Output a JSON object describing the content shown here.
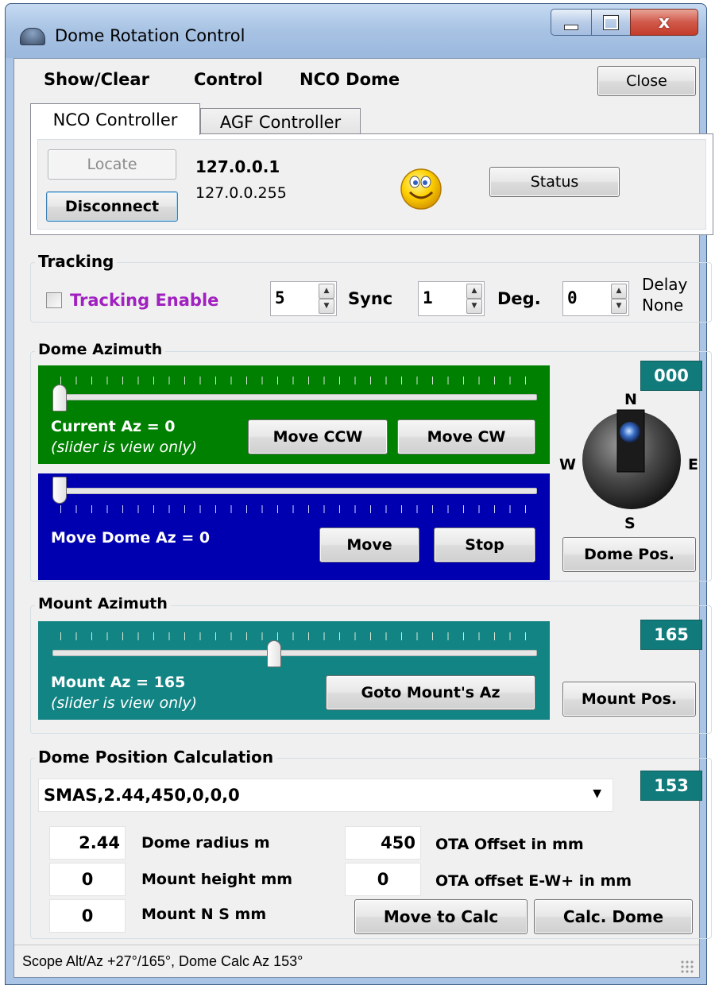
{
  "window": {
    "title": "Dome Rotation Control",
    "caption_buttons": {
      "minimize": "minimize",
      "maximize": "maximize",
      "close": "x"
    }
  },
  "menu": {
    "items": [
      "Show/Clear",
      "Control",
      "NCO Dome"
    ],
    "close_label": "Close"
  },
  "tabs": [
    {
      "label": "NCO Controller",
      "active": true
    },
    {
      "label": "AGF Controller",
      "active": false
    }
  ],
  "connection": {
    "locate_label": "Locate",
    "disconnect_label": "Disconnect",
    "ip_primary": "127.0.0.1",
    "ip_broadcast": "127.0.0.255",
    "status_icon": "smiley-icon",
    "status_label": "Status"
  },
  "tracking": {
    "title": "Tracking",
    "enable_label": "Tracking Enable",
    "enabled": false,
    "spin1_value": "5",
    "sync_label": "Sync",
    "spin2_value": "1",
    "deg_label": "Deg.",
    "spin3_value": "0",
    "delay_label": "Delay",
    "delay_value": "None"
  },
  "dome_azimuth": {
    "title": "Dome Azimuth",
    "readout": "000",
    "current_az_label": "Current Az = 0",
    "current_slider_value": 0,
    "view_only_note": "(slider is view only)",
    "move_ccw_label": "Move CCW",
    "move_cw_label": "Move CW",
    "move_dome_label": "Move Dome Az = 0",
    "move_slider_value": 0,
    "move_label": "Move",
    "stop_label": "Stop",
    "compass": {
      "n": "N",
      "s": "S",
      "e": "E",
      "w": "W"
    },
    "dome_pos_label": "Dome Pos."
  },
  "mount_azimuth": {
    "title": "Mount Azimuth",
    "readout": "165",
    "mount_az_label": "Mount Az = 165",
    "slider_value": 165,
    "view_only_note": "(slider is view only)",
    "goto_label": "Goto Mount's Az",
    "mount_pos_label": "Mount Pos."
  },
  "calculation": {
    "title": "Dome Position Calculation",
    "readout": "153",
    "profile_value": "SMAS,2.44,450,0,0,0",
    "fields": {
      "dome_radius_value": "2.44",
      "dome_radius_label": "Dome radius m",
      "ota_offset_value": "450",
      "ota_offset_label": "OTA Offset in mm",
      "mount_height_value": "0",
      "mount_height_label": "Mount height mm",
      "ota_ew_value": "0",
      "ota_ew_label": "OTA offset E-W+ in mm",
      "mount_ns_value": "0",
      "mount_ns_label": "Mount N S mm"
    },
    "move_to_calc_label": "Move to Calc",
    "calc_dome_label": "Calc. Dome"
  },
  "status_bar": {
    "text": "Scope Alt/Az +27°/165°, Dome Calc Az 153°"
  },
  "colors": {
    "current_az_panel": "#008000",
    "move_az_panel": "#0000b0",
    "mount_az_panel": "#138484",
    "readout_bg": "#117a7a",
    "tracking_enable_text": "#a020c0"
  }
}
